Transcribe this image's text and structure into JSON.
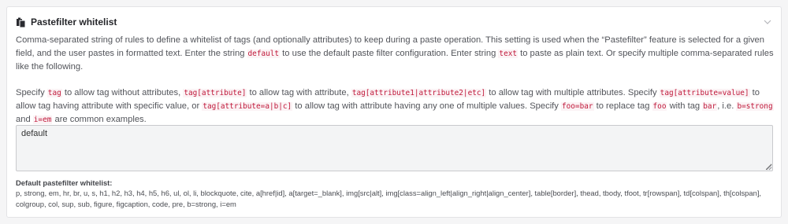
{
  "section": {
    "title": "Pastefilter whitelist",
    "icon": "clipboard-icon",
    "collapse_icon": "chevron-down-icon"
  },
  "description": {
    "p1": {
      "t1": "Comma-separated string of rules to define a whitelist of tags (and optionally attributes) to keep during a paste operation. This setting is used when the “Pastefilter” feature is selected for a given field, and the user pastes in formatted text. Enter the string ",
      "c1": "default",
      "t2": " to use the default paste filter configuration. Enter string ",
      "c2": "text",
      "t3": " to paste as plain text. Or specify multiple comma-separated rules like the following."
    },
    "p2": {
      "t1": "Specify ",
      "c1": "tag",
      "t2": " to allow tag without attributes, ",
      "c2": "tag[attribute]",
      "t3": " to allow tag with attribute, ",
      "c3": "tag[attribute1|attribute2|etc]",
      "t4": " to allow tag with multiple attributes. Specify ",
      "c4": "tag[attribute=value]",
      "t5": " to allow tag having attribute with specific value, or ",
      "c5": "tag[attribute=a|b|c]",
      "t6": " to allow tag with attribute having any one of multiple values. Specify ",
      "c6": "foo=bar",
      "t7": " to replace tag ",
      "c7": "foo",
      "t8": " with tag ",
      "c8": "bar",
      "t9": ", i.e. ",
      "c9": "b=strong",
      "t10": " and ",
      "c10": "i=em",
      "t11": " are common examples."
    }
  },
  "input": {
    "value": "default"
  },
  "defaults": {
    "label": "Default pastefilter whitelist:",
    "value": "p, strong, em, hr, br, u, s, h1, h2, h3, h4, h5, h6, ul, ol, li, blockquote, cite, a[href|id], a[target=_blank], img[src|alt], img[class=align_left|align_right|align_center], table[border], thead, tbody, tfoot, tr[rowspan], td[colspan], th[colspan], colgroup, col, sup, sub, figure, figcaption, code, pre, b=strong, i=em"
  },
  "colors": {
    "code_text": "#c0183a",
    "panel_bg": "#ffffff",
    "page_bg": "#f5f5f6"
  }
}
